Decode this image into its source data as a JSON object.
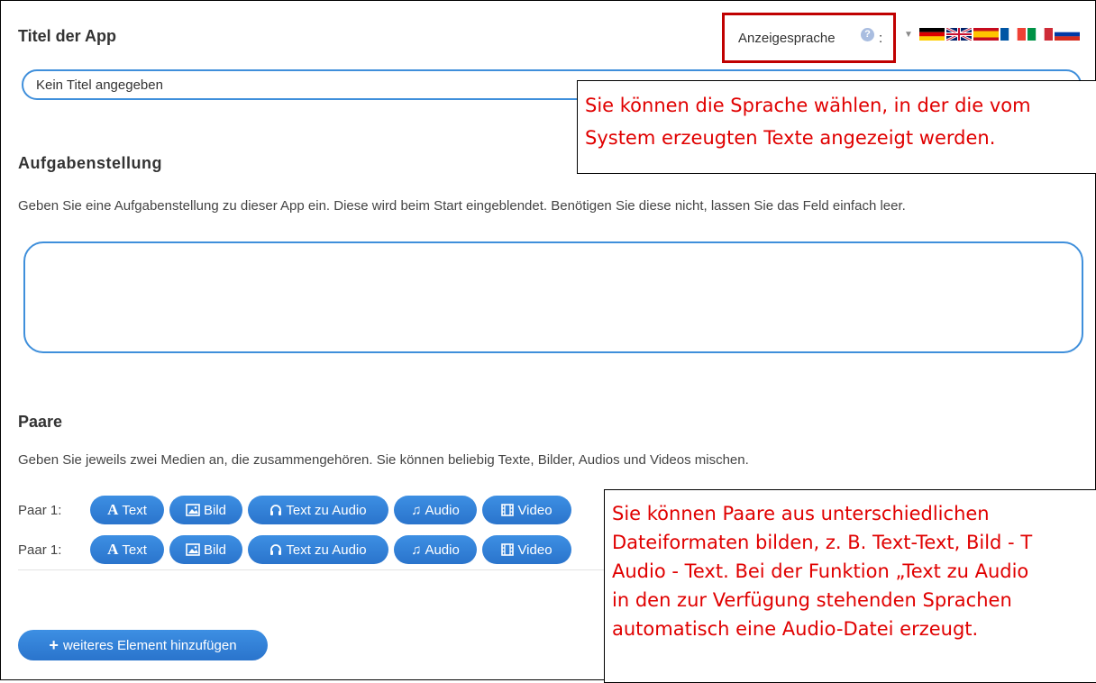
{
  "sections": {
    "title_heading": "Titel der App",
    "title_value": "Kein Titel angegeben",
    "task_heading": "Aufgabenstellung",
    "task_description": "Geben Sie eine Aufgabenstellung zu dieser App ein. Diese wird beim Start eingeblendet. Benötigen Sie diese nicht, lassen Sie das Feld einfach leer.",
    "task_value": "",
    "pairs_heading": "Paare",
    "pairs_description": "Geben Sie jeweils zwei Medien an, die zusammengehören. Sie können beliebig Texte, Bilder, Audios und Videos mischen."
  },
  "language": {
    "label": "Anzeigesprache",
    "help": "?",
    "colon": ":",
    "flags": [
      "de",
      "gb",
      "es",
      "fr",
      "it",
      "ru"
    ]
  },
  "pairs": [
    {
      "label": "Paar 1:",
      "buttons": {
        "text": "Text",
        "bild": "Bild",
        "tts": "Text zu Audio",
        "audio": "Audio",
        "video": "Video"
      }
    },
    {
      "label": "Paar 1:",
      "buttons": {
        "text": "Text",
        "bild": "Bild",
        "tts": "Text zu Audio",
        "audio": "Audio",
        "video": "Video"
      }
    }
  ],
  "add_button": "weiteres Element hinzufügen",
  "callouts": {
    "language": "Sie können die Sprache wählen, in der die vom\nSystem erzeugten Texte angezeigt werden.",
    "pairs": "Sie können Paare aus unterschiedlichen\nDateiformaten bilden, z. B. Text-Text, Bild - T\nAudio - Text. Bei der Funktion „Text zu Audio\nin den zur Verfügung stehenden Sprachen\nautomatisch eine Audio-Datei erzeugt."
  },
  "colors": {
    "accent": "#2f7fd9",
    "callout_text": "#e00000",
    "highlight_border": "#c00000"
  }
}
